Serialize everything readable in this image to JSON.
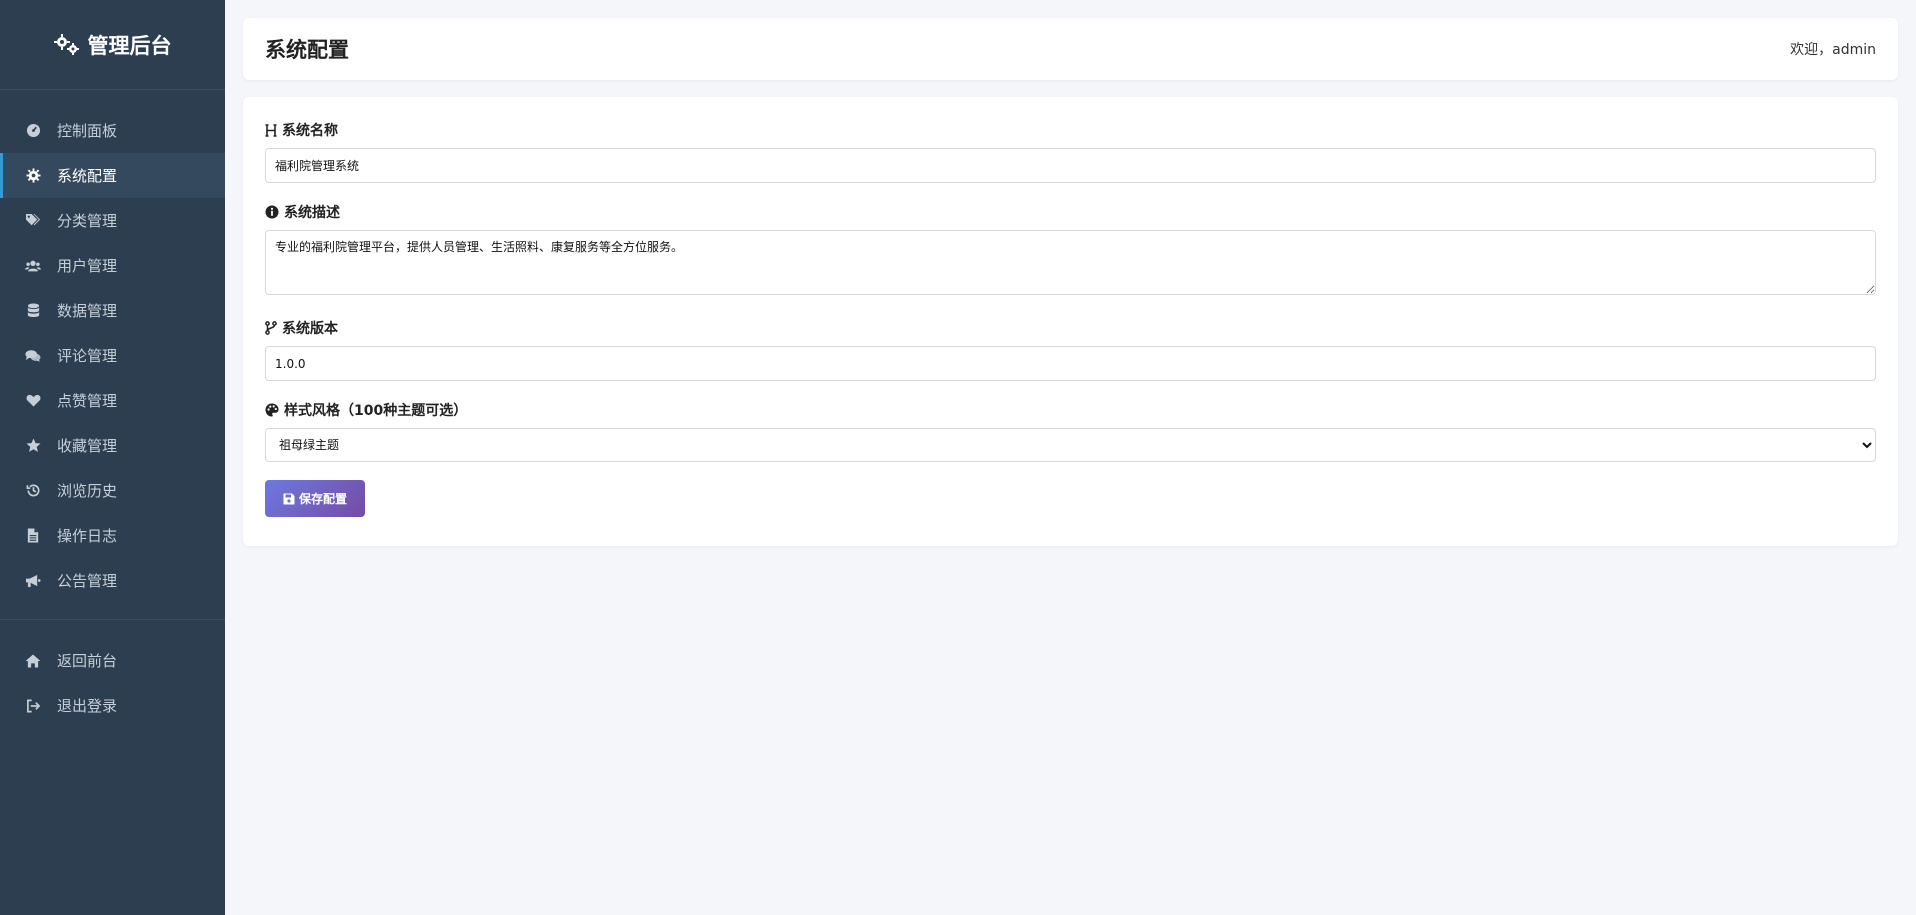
{
  "sidebar": {
    "brand": {
      "title": "管理后台",
      "icon": "gears-icon"
    },
    "items": [
      {
        "label": "控制面板",
        "icon": "dashboard-icon"
      },
      {
        "label": "系统配置",
        "icon": "gear-icon",
        "active": true
      },
      {
        "label": "分类管理",
        "icon": "tags-icon"
      },
      {
        "label": "用户管理",
        "icon": "users-icon"
      },
      {
        "label": "数据管理",
        "icon": "database-icon"
      },
      {
        "label": "评论管理",
        "icon": "comments-icon"
      },
      {
        "label": "点赞管理",
        "icon": "heart-icon"
      },
      {
        "label": "收藏管理",
        "icon": "star-icon"
      },
      {
        "label": "浏览历史",
        "icon": "history-icon"
      },
      {
        "label": "操作日志",
        "icon": "file-icon"
      },
      {
        "label": "公告管理",
        "icon": "bullhorn-icon"
      }
    ],
    "footer_items": [
      {
        "label": "返回前台",
        "icon": "home-icon"
      },
      {
        "label": "退出登录",
        "icon": "sign-out-icon"
      }
    ]
  },
  "header": {
    "title": "系统配置",
    "welcome": "欢迎，admin"
  },
  "form": {
    "name": {
      "label": "系统名称",
      "value": "福利院管理系统",
      "icon": "heading-icon"
    },
    "description": {
      "label": "系统描述",
      "value": "专业的福利院管理平台，提供人员管理、生活照料、康复服务等全方位服务。",
      "icon": "info-circle-icon"
    },
    "version": {
      "label": "系统版本",
      "value": "1.0.0",
      "icon": "code-branch-icon"
    },
    "theme": {
      "label": "样式风格（100种主题可选）",
      "value": "祖母绿主题",
      "icon": "palette-icon"
    },
    "save_label": "保存配置"
  },
  "colors": {
    "sidebar_bg": "#2c3e50",
    "active_bg": "#34495e",
    "active_accent": "#3498db",
    "page_bg": "#f5f6fa",
    "button_gradient_start": "#6c7ae0",
    "button_gradient_end": "#764ba2"
  }
}
